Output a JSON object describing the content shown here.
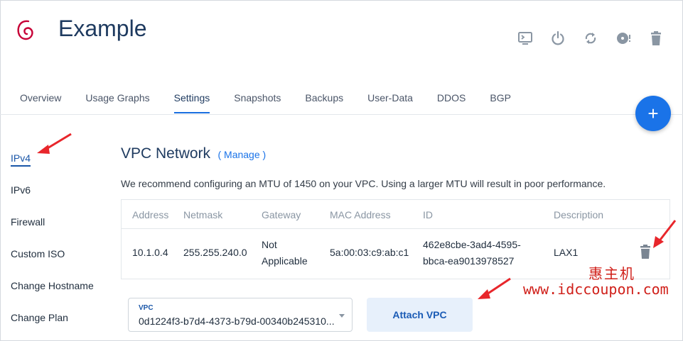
{
  "app": {
    "title": "Example"
  },
  "toolbar": {
    "icons": [
      "console-icon",
      "power-icon",
      "restart-icon",
      "iso-icon",
      "trash-icon"
    ]
  },
  "tabs": [
    {
      "label": "Overview"
    },
    {
      "label": "Usage Graphs"
    },
    {
      "label": "Settings",
      "active": true
    },
    {
      "label": "Snapshots"
    },
    {
      "label": "Backups"
    },
    {
      "label": "User-Data"
    },
    {
      "label": "DDOS"
    },
    {
      "label": "BGP"
    }
  ],
  "fab": {
    "symbol": "+"
  },
  "sidebar": {
    "items": [
      {
        "label": "IPv4",
        "active": true
      },
      {
        "label": "IPv6"
      },
      {
        "label": "Firewall"
      },
      {
        "label": "Custom ISO"
      },
      {
        "label": "Change Hostname"
      },
      {
        "label": "Change Plan"
      }
    ]
  },
  "vpc": {
    "title": "VPC Network",
    "manage_label": "( Manage )",
    "advice": "We recommend configuring an MTU of 1450 on your VPC. Using a larger MTU will result in poor performance.",
    "columns": [
      "Address",
      "Netmask",
      "Gateway",
      "MAC Address",
      "ID",
      "Description"
    ],
    "row": {
      "address": "10.1.0.4",
      "netmask": "255.255.240.0",
      "gateway_line1": "Not",
      "gateway_line2": "Applicable",
      "mac": "5a:00:03:c9:ab:c1",
      "id_line1": "462e8cbe-3ad4-4595-",
      "id_line2": "bbca-ea9013978527",
      "description": "LAX1"
    },
    "select_label": "VPC",
    "select_value": "0d1224f3-b7d4-4373-b79d-00340b245310...",
    "attach_label": "Attach VPC"
  },
  "watermark": {
    "line1": "惠主机",
    "line2": "www.idccoupon.com"
  },
  "colors": {
    "accent": "#1a73e8",
    "annotation": "#e8262b"
  }
}
